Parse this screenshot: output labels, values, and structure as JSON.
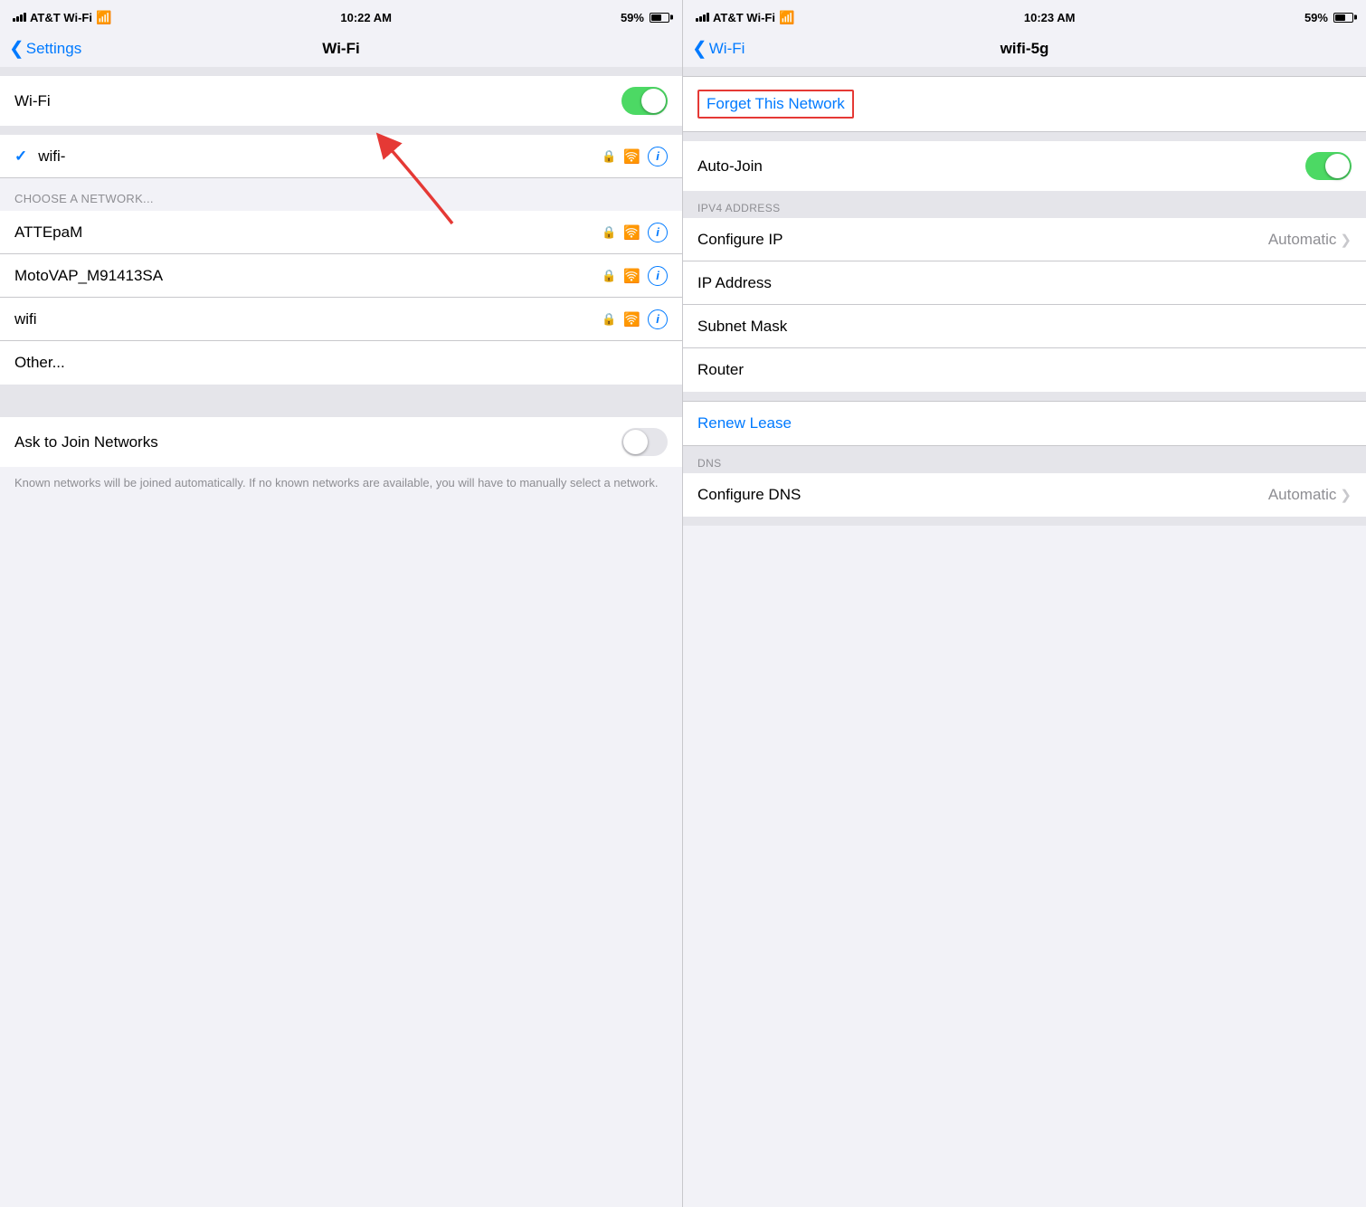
{
  "left": {
    "statusBar": {
      "carrier": "AT&T Wi-Fi",
      "time": "10:22 AM",
      "battery": "59%"
    },
    "navBar": {
      "backLabel": "Settings",
      "title": "Wi-Fi"
    },
    "wifiRow": {
      "label": "Wi-Fi"
    },
    "connectedNetwork": {
      "name": "wifi-"
    },
    "chooseNetworkHeader": "CHOOSE A NETWORK...",
    "networks": [
      {
        "name": "ATTEpaM"
      },
      {
        "name": "MotoVAP_M91413SA"
      },
      {
        "name": "wifi"
      }
    ],
    "otherLabel": "Other...",
    "askToJoinRow": {
      "label": "Ask to Join Networks"
    },
    "footerText": "Known networks will be joined automatically. If no known networks are available, you will have to manually select a network."
  },
  "right": {
    "statusBar": {
      "carrier": "AT&T Wi-Fi",
      "time": "10:23 AM",
      "battery": "59%"
    },
    "navBar": {
      "backLabel": "Wi-Fi",
      "title": "wifi-5g"
    },
    "forgetNetwork": "Forget This Network",
    "autoJoinRow": {
      "label": "Auto-Join"
    },
    "ipv4Header": "IPV4 ADDRESS",
    "ipRows": [
      {
        "label": "Configure IP",
        "value": "Automatic",
        "hasChevron": true
      },
      {
        "label": "IP Address",
        "value": "",
        "hasChevron": false
      },
      {
        "label": "Subnet Mask",
        "value": "",
        "hasChevron": false
      },
      {
        "label": "Router",
        "value": "",
        "hasChevron": false
      }
    ],
    "renewLease": "Renew Lease",
    "dnsHeader": "DNS",
    "dnsRows": [
      {
        "label": "Configure DNS",
        "value": "Automatic",
        "hasChevron": true
      }
    ]
  }
}
